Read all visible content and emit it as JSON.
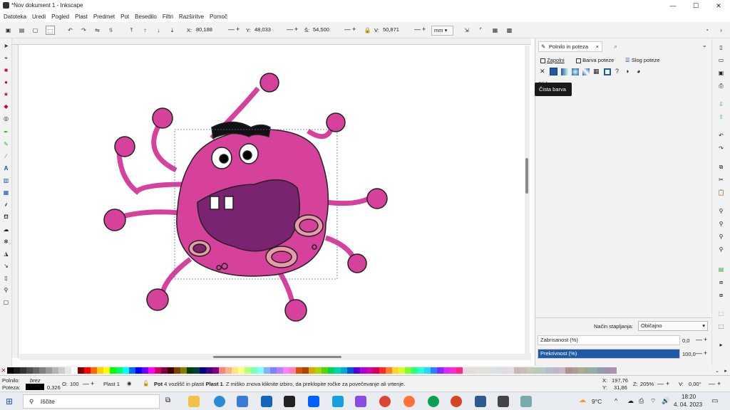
{
  "window": {
    "title": "*Nov dokument 1 - Inkscape",
    "minimize": "—",
    "maximize": "☐",
    "close": "✕"
  },
  "menu": [
    "Datoteka",
    "Uredi",
    "Pogled",
    "Plast",
    "Predmet",
    "Pot",
    "Besedilo",
    "Filtri",
    "Razširitve",
    "Pomoč"
  ],
  "tool_controls": {
    "x_label": "X:",
    "x_value": "80,188",
    "y_label": "Y:",
    "y_value": "48,033",
    "w_label": "Š:",
    "w_value": "54,500",
    "h_label": "V:",
    "h_value": "50,871",
    "unit": "mm",
    "minus": "—",
    "plus": "+"
  },
  "panel": {
    "tab_label": "Polnilo in poteza",
    "tab_close": "×",
    "subtabs": [
      "Zapolni",
      "Barva poteze",
      "Slog poteze"
    ],
    "fill_type": "Ni barve",
    "tooltip": "Čista barva",
    "blend_label": "Način stapljanja:",
    "blend_value": "Običajno",
    "blur_label": "Zabrisanost (%)",
    "blur_value": "0,0",
    "opacity_label": "Prekrivnost (%)",
    "opacity_value": "100,0",
    "accent": "#1e5aa8"
  },
  "status": {
    "fill_label": "Polnilo:",
    "fill_value": "brez",
    "stroke_label": "Poteza:",
    "stroke_width": "0,326",
    "opacity_label": "O:",
    "opacity_value": "100",
    "layer": "Plast 1",
    "message_bold": "Pot",
    "message": "4 vozlišč in plasti",
    "message_layer": "Plast 1",
    "message_rest": ". Z miško znova kliknite izbiro, da preklopite ročke za povečevanje ali vrtenje.",
    "x_label": "X:",
    "x_coord": "197,76",
    "y_label": "Y:",
    "y_coord": "31,86",
    "zoom_label": "Z:",
    "zoom_value": "205%",
    "rot_label": "V:",
    "rot_value": "0,00°"
  },
  "taskbar": {
    "search_placeholder": "Iščite",
    "temperature": "9°C",
    "time": "18:20",
    "date": "4. 04. 2023"
  },
  "palette_colors": [
    "#000000",
    "#1a1a1a",
    "#333333",
    "#4d4d4d",
    "#666666",
    "#808080",
    "#999999",
    "#b3b3b3",
    "#cccccc",
    "#e6e6e6",
    "#ffffff",
    "#800000",
    "#ff0000",
    "#ff6600",
    "#ffcc00",
    "#ffff00",
    "#00ff00",
    "#00ff66",
    "#00ffff",
    "#0066ff",
    "#0000ff",
    "#6600ff",
    "#ff00ff",
    "#cc0066",
    "#800040",
    "#400000",
    "#804000",
    "#808000",
    "#004000",
    "#004040",
    "#000080",
    "#400080",
    "#800080",
    "#ff8080",
    "#ffb380",
    "#ffe680",
    "#ffff80",
    "#b3ff80",
    "#80ffb3",
    "#80ffff",
    "#80b3ff",
    "#8080ff",
    "#b380ff",
    "#ff80ff",
    "#ff80b3",
    "#d45500",
    "#aa4400",
    "#d4aa00",
    "#aad400",
    "#55d400",
    "#00d455",
    "#00d4aa",
    "#00aad4",
    "#0055d4",
    "#5500d4",
    "#aa00d4",
    "#d400aa",
    "#d40055",
    "#ff2a2a",
    "#ff7f2a",
    "#ffd42a",
    "#d4ff2a",
    "#7fff2a",
    "#2aff7f",
    "#2affd4",
    "#2ad4ff",
    "#2a7fff",
    "#7f2aff",
    "#d42aff",
    "#ff2ad4",
    "#ff2a7f",
    "#e3dbdb",
    "#e3dedb",
    "#e3e3db",
    "#dee3db",
    "#dbe3e3",
    "#dbdee3",
    "#dedbe3",
    "#e3dbe3",
    "#c8b7b7",
    "#c8beb7",
    "#c8c8b7",
    "#bec8b7",
    "#b7c8c8",
    "#b7bec8",
    "#beb7c8",
    "#c8b7c8",
    "#ac9393",
    "#ac9d93",
    "#acac93",
    "#9dac93",
    "#93acac",
    "#939dac",
    "#9d93ac",
    "#ac93ac"
  ]
}
